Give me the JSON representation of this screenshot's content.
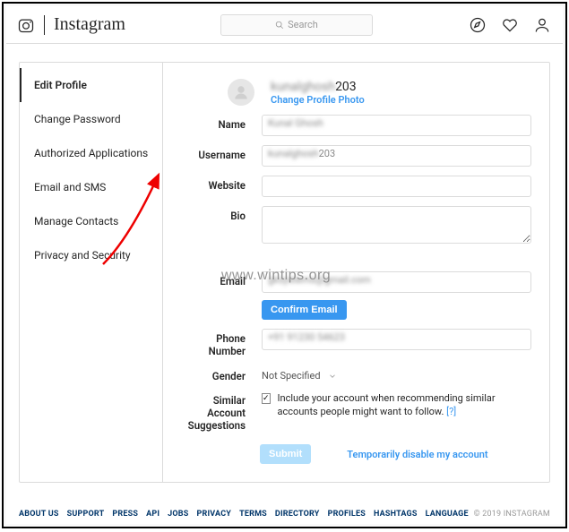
{
  "header": {
    "brand": "Instagram",
    "search_placeholder": "Search"
  },
  "sidebar": {
    "items": [
      {
        "label": "Edit Profile"
      },
      {
        "label": "Change Password"
      },
      {
        "label": "Authorized Applications"
      },
      {
        "label": "Email and SMS"
      },
      {
        "label": "Manage Contacts"
      },
      {
        "label": "Privacy and Security"
      }
    ]
  },
  "profile": {
    "username_blur": "kunalghosh",
    "username_suffix": "203",
    "change_photo": "Change Profile Photo"
  },
  "form": {
    "name_label": "Name",
    "name_value": "Kunal Ghosh",
    "username_label": "Username",
    "username_value_blur": "kunalghosh",
    "username_value_suffix": "203",
    "website_label": "Website",
    "website_value": "",
    "bio_label": "Bio",
    "bio_value": "",
    "email_label": "Email",
    "email_value": "gksystems@gmail.com",
    "confirm_email": "Confirm Email",
    "phone_label": "Phone Number",
    "phone_value": "+91 91230 54623",
    "gender_label": "Gender",
    "gender_value": "Not Specified",
    "similar_label": "Similar Account Suggestions",
    "similar_text": "Include your account when recommending similar accounts people might want to follow.",
    "similar_link": "[?]",
    "submit": "Submit",
    "disable_link": "Temporarily disable my account"
  },
  "footer": {
    "links": [
      "ABOUT US",
      "SUPPORT",
      "PRESS",
      "API",
      "JOBS",
      "PRIVACY",
      "TERMS",
      "DIRECTORY",
      "PROFILES",
      "HASHTAGS",
      "LANGUAGE"
    ],
    "copyright": "© 2019 INSTAGRAM"
  },
  "watermark": "www.wintips.org"
}
